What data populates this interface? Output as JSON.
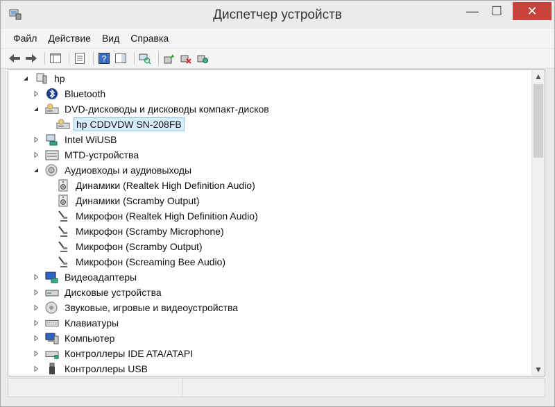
{
  "window": {
    "title": "Диспетчер устройств"
  },
  "menu": [
    "Файл",
    "Действие",
    "Вид",
    "Справка"
  ],
  "tree": {
    "root": "hp",
    "nodes": [
      {
        "label": "Bluetooth",
        "icon": "bluetooth-icon",
        "state": "collapsed"
      },
      {
        "label": "DVD-дисководы и дисководы компакт-дисков",
        "icon": "dvd-drive-icon",
        "state": "expanded",
        "children": [
          {
            "label": "hp CDDVDW SN-208FB",
            "icon": "dvd-drive-icon",
            "selected": true
          }
        ]
      },
      {
        "label": "Intel WiUSB",
        "icon": "network-icon",
        "state": "collapsed"
      },
      {
        "label": "MTD-устройства",
        "icon": "mtd-device-icon",
        "state": "collapsed"
      },
      {
        "label": "Аудиовходы и аудиовыходы",
        "icon": "audio-io-icon",
        "state": "expanded",
        "children": [
          {
            "label": "Динамики (Realtek High Definition Audio)",
            "icon": "speaker-icon"
          },
          {
            "label": "Динамики (Scramby Output)",
            "icon": "speaker-icon"
          },
          {
            "label": "Микрофон (Realtek High Definition Audio)",
            "icon": "microphone-icon"
          },
          {
            "label": "Микрофон (Scramby Microphone)",
            "icon": "microphone-icon"
          },
          {
            "label": "Микрофон (Scramby Output)",
            "icon": "microphone-icon"
          },
          {
            "label": "Микрофон (Screaming Bee Audio)",
            "icon": "microphone-icon"
          }
        ]
      },
      {
        "label": "Видеоадаптеры",
        "icon": "display-adapter-icon",
        "state": "collapsed"
      },
      {
        "label": "Дисковые устройства",
        "icon": "disk-drive-icon",
        "state": "collapsed"
      },
      {
        "label": "Звуковые, игровые и видеоустройства",
        "icon": "sound-device-icon",
        "state": "collapsed"
      },
      {
        "label": "Клавиатуры",
        "icon": "keyboard-icon",
        "state": "collapsed"
      },
      {
        "label": "Компьютер",
        "icon": "computer-icon",
        "state": "collapsed"
      },
      {
        "label": "Контроллеры IDE ATA/ATAPI",
        "icon": "ide-controller-icon",
        "state": "collapsed"
      },
      {
        "label": "Контроллеры USB",
        "icon": "usb-icon",
        "state": "collapsed"
      }
    ]
  }
}
